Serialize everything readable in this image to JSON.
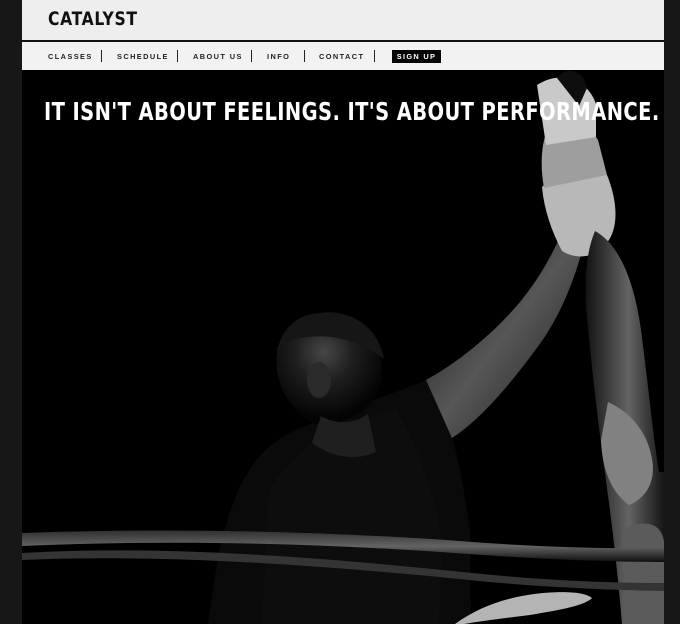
{
  "site": {
    "brand": "CATALYST"
  },
  "nav": {
    "items": [
      {
        "label": "CLASSES"
      },
      {
        "label": "SCHEDULE"
      },
      {
        "label": "ABOUT US"
      },
      {
        "label": "INFO"
      },
      {
        "label": "CONTACT"
      }
    ],
    "signup_label": "SIGN UP"
  },
  "hero": {
    "headline": "IT ISN'T ABOUT FEELINGS. IT'S ABOUT PERFORMANCE.",
    "image": "black-and-white boxing ring photo with referee raising fighter's arm"
  },
  "colors": {
    "page_background": "#171717",
    "header_background": "#eeeeee",
    "hero_background": "#000000",
    "signup_background": "#050505",
    "text_dark": "#111111",
    "text_light": "#ffffff"
  }
}
